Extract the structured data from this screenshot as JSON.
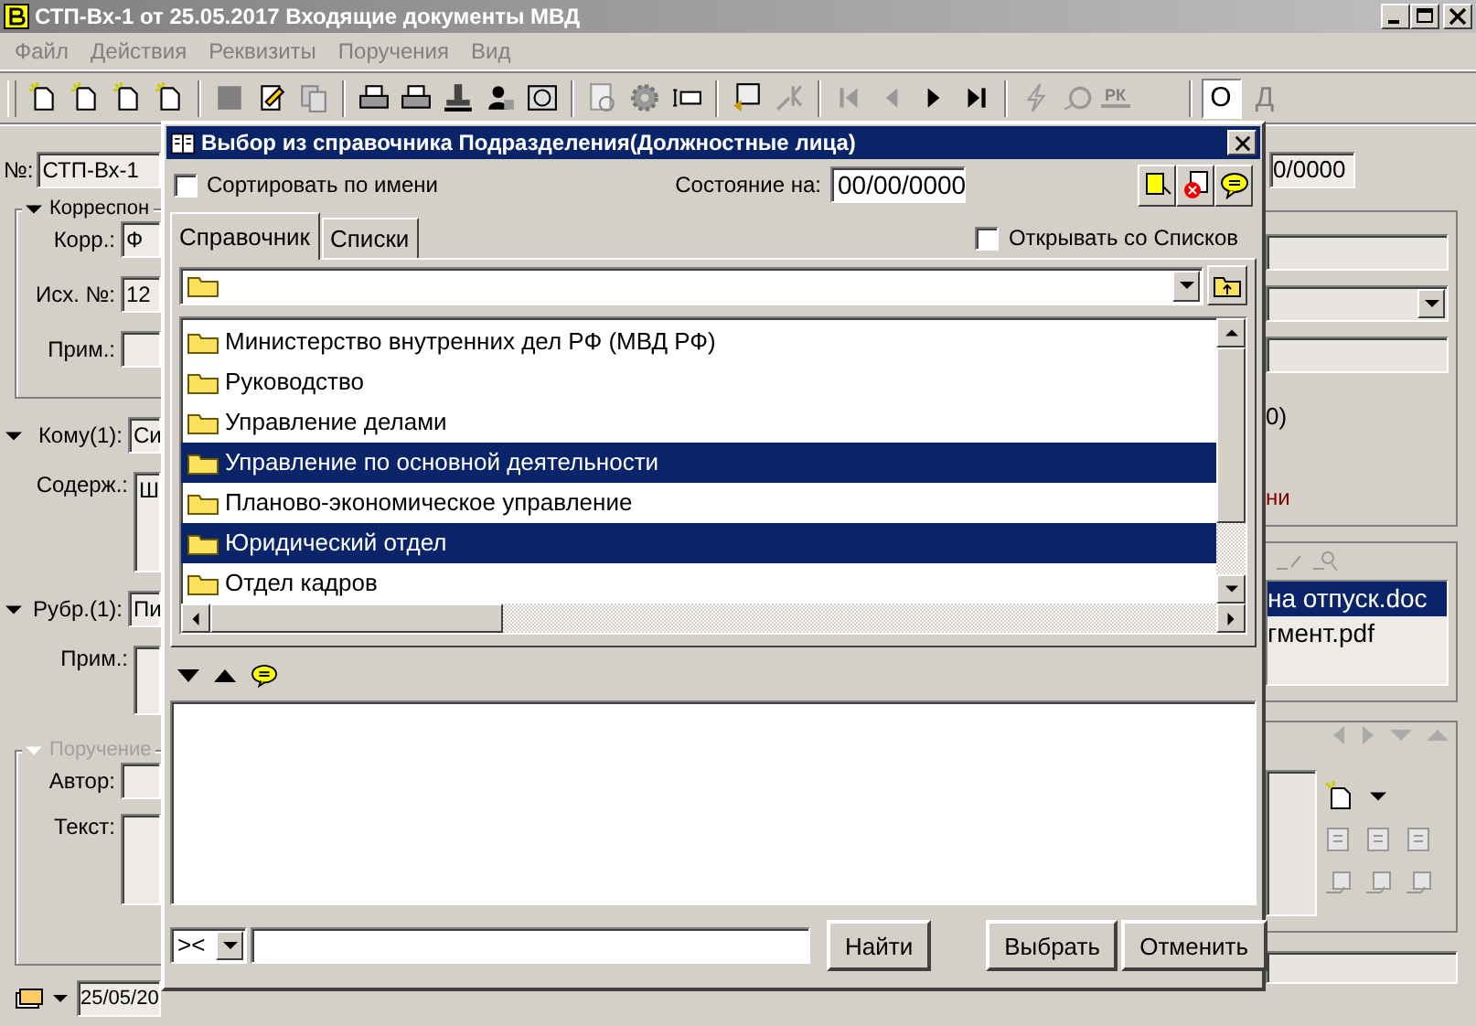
{
  "window": {
    "title": "СТП-Вх-1 от 25.05.2017 Входящие документы МВД"
  },
  "menu": [
    "Файл",
    "Действия",
    "Реквизиты",
    "Поручения",
    "Вид"
  ],
  "toolbar": {
    "badge": "РК",
    "toggles": [
      {
        "label": "О",
        "selected": true
      },
      {
        "label": "Д",
        "selected": false
      }
    ]
  },
  "form": {
    "number": {
      "label": "№:",
      "value": "СТП-Вх-1"
    },
    "correspondent": {
      "title": "Корреспон",
      "fields": [
        {
          "label": "Корр.:",
          "value": "Ф"
        },
        {
          "label": "Исх. №:",
          "value": "12"
        },
        {
          "label": "Прим.:"
        }
      ]
    },
    "addressee": {
      "label": "Кому(1):",
      "value": "Си"
    },
    "content": {
      "label": "Содерж.:",
      "value": "Ш"
    },
    "rubric": {
      "label": "Рубр.(1):",
      "value": "Пи"
    },
    "note": {
      "label": "Прим.:"
    },
    "assignment": {
      "title": "Поручение",
      "disabled": true,
      "fields": [
        {
          "label": "Автор:"
        },
        {
          "label": "Текст:"
        }
      ]
    },
    "status_date": "25/05/20"
  },
  "right": {
    "date_value": "0/0000",
    "text_1": "0)",
    "text_2": "ни",
    "files": [
      {
        "name": "на отпуск.doc",
        "selected": true
      },
      {
        "name": "гмент.pdf",
        "selected": false
      }
    ]
  },
  "dialog": {
    "title": "Выбор из справочника Подразделения(Должностные лица)",
    "sort_by_name": {
      "label": "Сортировать по имени",
      "checked": false
    },
    "state_label": "Состояние на:",
    "state_date": "00/00/0000",
    "tabs": [
      {
        "label": "Справочник",
        "selected": true
      },
      {
        "label": "Списки",
        "selected": false
      }
    ],
    "open_with_lists": {
      "label": "Открывать со Списков",
      "checked": false
    },
    "tree_items": [
      {
        "name": "Министерство внутренних дел РФ (МВД РФ)",
        "selected": false
      },
      {
        "name": "Руководство",
        "selected": false
      },
      {
        "name": "Управление делами",
        "selected": false
      },
      {
        "name": "Управление по основной деятельности",
        "selected": true
      },
      {
        "name": "Планово-экономическое управление",
        "selected": false
      },
      {
        "name": "Юридический отдел",
        "selected": true
      },
      {
        "name": "Отдел кадров",
        "selected": false
      }
    ],
    "search_mode": "><",
    "buttons": {
      "find": "Найти",
      "select": "Выбрать",
      "cancel": "Отменить"
    }
  }
}
